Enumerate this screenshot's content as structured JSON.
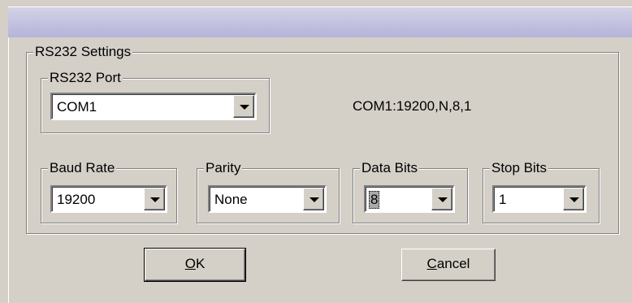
{
  "window": {
    "title": ""
  },
  "rs232": {
    "group_label": "RS232 Settings",
    "port": {
      "label": "RS232 Port",
      "value": "COM1"
    },
    "summary": "COM1:19200,N,8,1",
    "baud_rate": {
      "label": "Baud Rate",
      "value": "19200"
    },
    "parity": {
      "label": "Parity",
      "value": "None"
    },
    "data_bits": {
      "label": "Data Bits",
      "value": "8"
    },
    "stop_bits": {
      "label": "Stop Bits",
      "value": "1"
    }
  },
  "buttons": {
    "ok": {
      "mnemonic": "O",
      "rest": "K"
    },
    "cancel": {
      "mnemonic": "C",
      "rest": "ancel"
    }
  },
  "icons": {
    "dropdown": "chevron-down-icon"
  }
}
